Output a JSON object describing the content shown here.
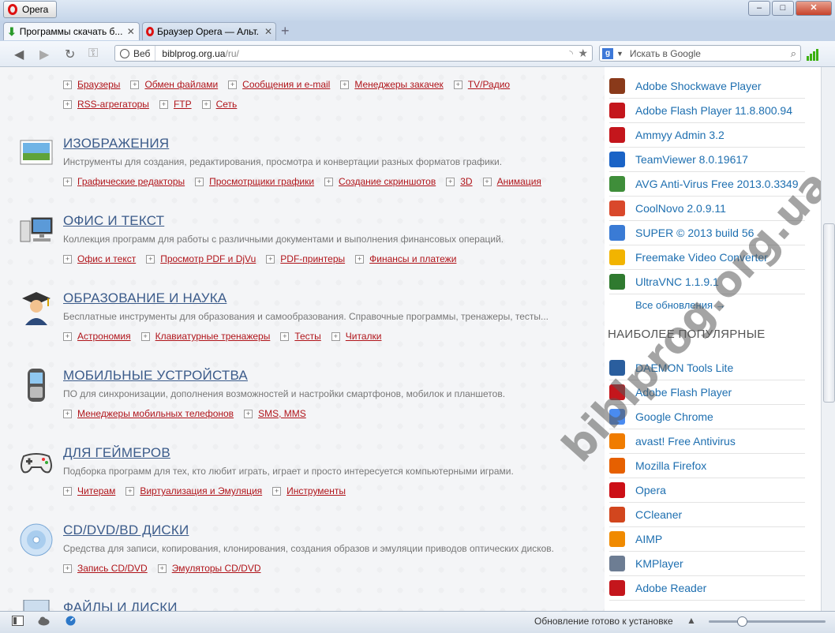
{
  "window": {
    "app_button": "Opera",
    "controls": [
      "–",
      "□",
      "✕"
    ]
  },
  "tabs": [
    {
      "title": "Программы скачать б...",
      "close": "✕"
    },
    {
      "title": "Браузер Opera — Альт...",
      "close": "✕"
    }
  ],
  "new_tab": "+",
  "address": {
    "badge": "Веб",
    "host": "biblprog.org.ua",
    "path": "/ru/"
  },
  "search": {
    "engine": "g",
    "placeholder": "Искать в Google"
  },
  "categories": [
    {
      "title": "",
      "desc": "",
      "links": [
        [
          "Браузеры",
          "Обмен файлами",
          "Сообщения и e-mail",
          "Менеджеры закачек",
          "TV/Радио"
        ],
        [
          "RSS-агрегаторы",
          "FTP",
          "Сеть"
        ]
      ]
    },
    {
      "title": "ИЗОБРАЖЕНИЯ",
      "desc": "Инструменты для создания, редактирования, просмотра и конвертации разных форматов графики.",
      "links": [
        [
          "Графические редакторы",
          "Просмотрщики графики",
          "Создание скриншотов",
          "3D",
          "Анимация"
        ]
      ]
    },
    {
      "title": "ОФИС И ТЕКСТ",
      "desc": "Коллекция программ для работы с различными документами и выполнения финансовых операций.",
      "links": [
        [
          "Офис и текст",
          "Просмотр PDF и DjVu",
          "PDF-принтеры",
          "Финансы и платежи"
        ]
      ]
    },
    {
      "title": "ОБРАЗОВАНИЕ И НАУКА",
      "desc": "Бесплатные инструменты для образования и самообразования. Справочные программы, тренажеры, тесты...",
      "links": [
        [
          "Астрономия",
          "Клавиатурные тренажеры",
          "Тесты",
          "Читалки"
        ]
      ]
    },
    {
      "title": "МОБИЛЬНЫЕ УСТРОЙСТВА",
      "desc": "ПО для синхронизации, дополнения возможностей и настройки смартфонов, мобилок и планшетов.",
      "links": [
        [
          "Менеджеры мобильных телефонов",
          "SMS, MMS"
        ]
      ]
    },
    {
      "title": "ДЛЯ ГЕЙМЕРОВ",
      "desc": "Подборка программ для тех, кто любит играть, играет и просто интересуется компьютерными играми.",
      "links": [
        [
          "Читерам",
          "Виртуализация и Эмуляция",
          "Инструменты"
        ]
      ]
    },
    {
      "title": "CD/DVD/BD ДИСКИ",
      "desc": "Средства для записи, копирования, клонирования, создания образов и эмуляции приводов оптических дисков.",
      "links": [
        [
          "Запись CD/DVD",
          "Эмуляторы CD/DVD"
        ]
      ]
    },
    {
      "title": "ФАЙЛЫ И ДИСКИ",
      "desc": "",
      "links": []
    }
  ],
  "updates": [
    {
      "name": "Adobe Shockwave Player",
      "icon": "shockwave-icon",
      "color": "#8a3a1a"
    },
    {
      "name": "Adobe Flash Player 11.8.800.94",
      "icon": "flash-icon",
      "color": "#c4161c"
    },
    {
      "name": "Ammyy Admin 3.2",
      "icon": "ammyy-icon",
      "color": "#c4161c"
    },
    {
      "name": "TeamViewer 8.0.19617",
      "icon": "teamviewer-icon",
      "color": "#1a63c6"
    },
    {
      "name": "AVG Anti-Virus Free 2013.0.3349",
      "icon": "avg-icon",
      "color": "#3f8e3a"
    },
    {
      "name": "CoolNovo 2.0.9.11",
      "icon": "coolnovo-icon",
      "color": "#d9482b"
    },
    {
      "name": "SUPER © 2013 build 56",
      "icon": "super-icon",
      "color": "#3a7bd5"
    },
    {
      "name": "Freemake Video Converter",
      "icon": "freemake-icon",
      "color": "#f2b400"
    },
    {
      "name": "UltraVNC 1.1.9.1",
      "icon": "ultravnc-icon",
      "color": "#2f7a2f"
    }
  ],
  "all_updates": "Все обновления →",
  "popular_header": "НАИБОЛЕЕ ПОПУЛЯРНЫЕ",
  "popular": [
    {
      "name": "DAEMON Tools Lite",
      "icon": "daemon-tools-icon",
      "color": "#2a5e9e"
    },
    {
      "name": "Adobe Flash Player",
      "icon": "flash-icon",
      "color": "#c4161c"
    },
    {
      "name": "Google Chrome",
      "icon": "chrome-icon",
      "color": "#4a8bf0"
    },
    {
      "name": "avast! Free Antivirus",
      "icon": "avast-icon",
      "color": "#f07c00"
    },
    {
      "name": "Mozilla Firefox",
      "icon": "firefox-icon",
      "color": "#e66000"
    },
    {
      "name": "Opera",
      "icon": "opera-icon",
      "color": "#cc0f16"
    },
    {
      "name": "CCleaner",
      "icon": "ccleaner-icon",
      "color": "#d2461e"
    },
    {
      "name": "AIMP",
      "icon": "aimp-icon",
      "color": "#f08a00"
    },
    {
      "name": "KMPlayer",
      "icon": "kmplayer-icon",
      "color": "#6d7d93"
    },
    {
      "name": "Adobe Reader",
      "icon": "adobe-reader-icon",
      "color": "#c4161c"
    }
  ],
  "watermark": "biblprog.org.ua",
  "status": "Обновление готово к установке"
}
